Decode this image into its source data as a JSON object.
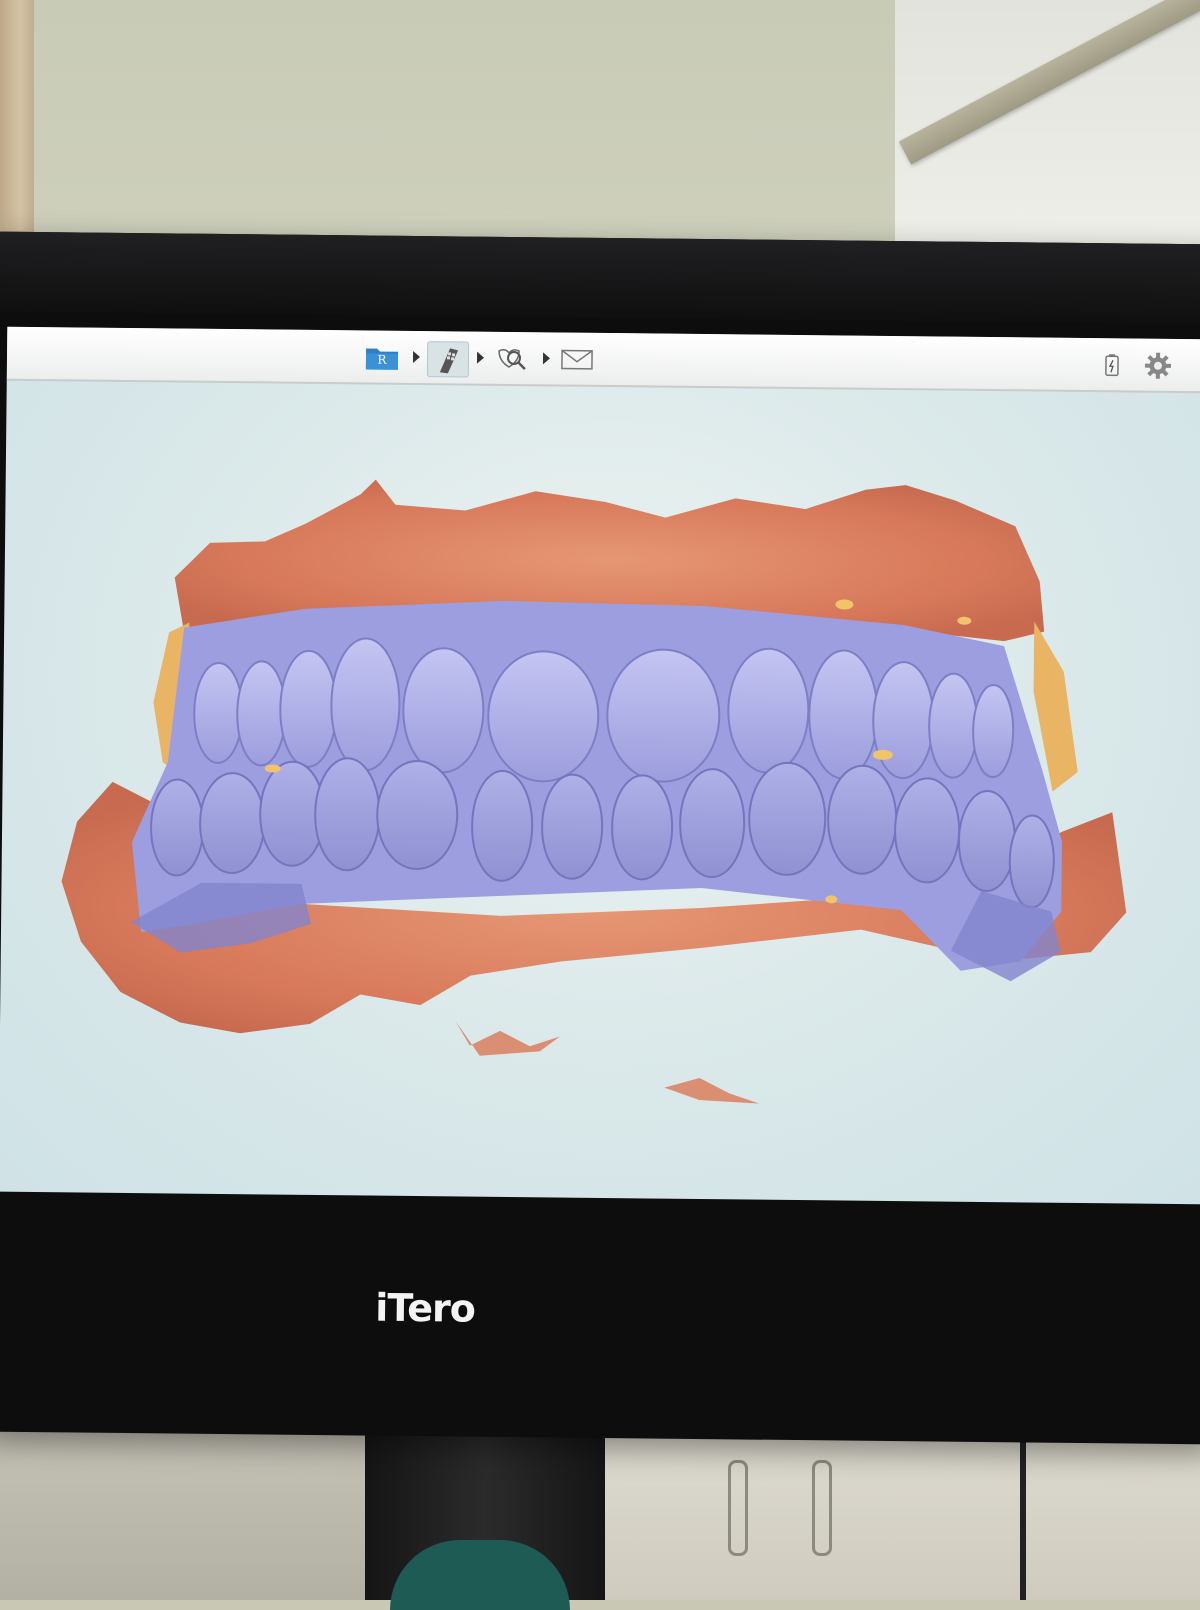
{
  "device": {
    "brand": "iTero"
  },
  "toolbar": {
    "workflow_steps": [
      {
        "id": "patient-rx",
        "icon": "folder-icon",
        "letter": "R",
        "active": false
      },
      {
        "id": "scan",
        "icon": "scanner-wand-icon",
        "active": true
      },
      {
        "id": "view",
        "icon": "magnify-view-icon",
        "active": false
      },
      {
        "id": "send",
        "icon": "envelope-icon",
        "active": false
      }
    ],
    "right_icons": [
      "battery-icon",
      "gear-icon"
    ]
  },
  "scan_view": {
    "subject": "3d-intraoral-scan-full-arches",
    "colors": {
      "teeth": "#a7a8e3",
      "gingiva": "#d77b5c",
      "highlight": "#f2c46a",
      "background": "#dbe9ea"
    }
  }
}
